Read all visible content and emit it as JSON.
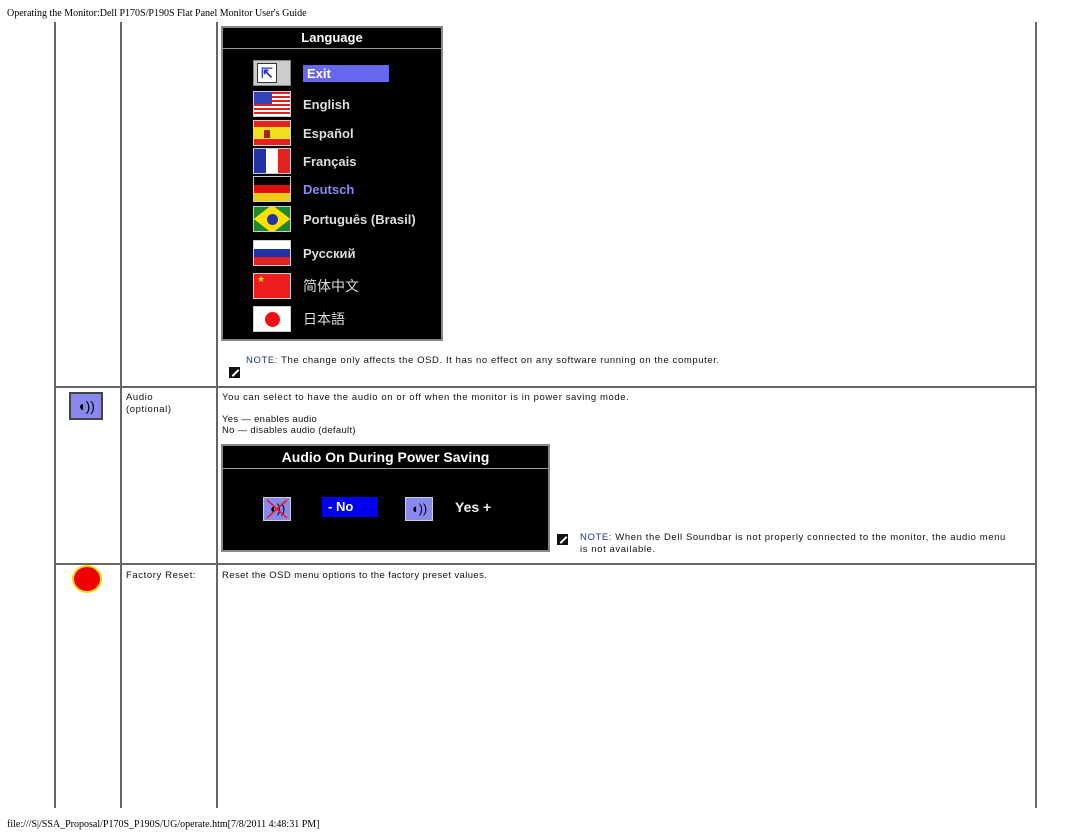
{
  "page": {
    "header": "Operating the Monitor:Dell P170S/P190S Flat Panel Monitor User's Guide",
    "footer": "file:///S|/SSA_Proposal/P170S_P190S/UG/operate.htm[7/8/2011 4:48:31 PM]"
  },
  "language_osd": {
    "title": "Language",
    "items": [
      {
        "label": "Exit",
        "icon": "exit-icon",
        "selected": true
      },
      {
        "label": "English",
        "icon": "flag-us-icon"
      },
      {
        "label": "Español",
        "icon": "flag-es-icon"
      },
      {
        "label": "Français",
        "icon": "flag-fr-icon"
      },
      {
        "label": "Deutsch",
        "icon": "flag-de-icon"
      },
      {
        "label": "Português (Brasil)",
        "icon": "flag-br-icon"
      },
      {
        "label": "Русский",
        "icon": "flag-ru-icon"
      },
      {
        "label": "简体中文",
        "icon": "flag-cn-icon"
      },
      {
        "label": "日本語",
        "icon": "flag-jp-icon"
      }
    ],
    "note_label": "NOTE:",
    "note_text": " The change only affects the OSD. It has no effect on any software running on the computer."
  },
  "rows": [
    {
      "name_line1": "Audio",
      "name_line2": "(optional)",
      "icon": "speaker-icon",
      "description": "You can select to have the audio on or off when the monitor is in power saving mode.",
      "option_yes": "Yes — enables audio",
      "option_no": "No — disables audio (default)",
      "osd": {
        "title": "Audio On During Power Saving",
        "no_label": "- No",
        "yes_label": "Yes +"
      },
      "note_label": "NOTE:",
      "note_text_line1": " When the Dell Soundbar is not properly connected to the monitor, the audio menu",
      "note_text_line2": "is not available."
    },
    {
      "name": "Factory Reset:",
      "icon": "reset-icon",
      "description": "Reset the OSD menu options to  the factory preset values."
    }
  ],
  "colors": {
    "osd_background": "#000000",
    "osd_selected": "#6666ee",
    "audio_selected": "#0000ee",
    "icon_background": "#8888ee",
    "note_label": "#1a3a8a",
    "reset_red": "#ee0000"
  }
}
